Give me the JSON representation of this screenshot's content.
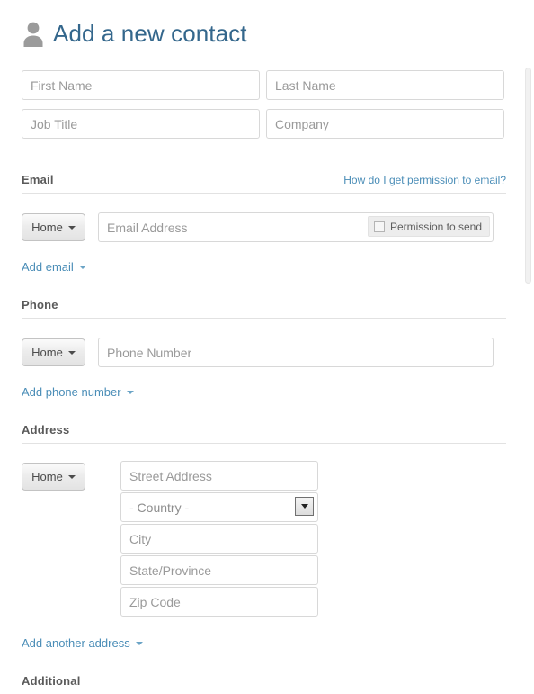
{
  "header": {
    "icon": "person-icon",
    "title": "Add a new contact"
  },
  "name_fields": {
    "first_name_placeholder": "First Name",
    "last_name_placeholder": "Last Name",
    "job_title_placeholder": "Job Title",
    "company_placeholder": "Company"
  },
  "email_section": {
    "title": "Email",
    "help_link": "How do I get permission to email?",
    "type_button": "Home",
    "address_placeholder": "Email Address",
    "permission_label": "Permission to send",
    "permission_checked": false,
    "add_link": "Add email"
  },
  "phone_section": {
    "title": "Phone",
    "type_button": "Home",
    "number_placeholder": "Phone Number",
    "add_link": "Add phone number"
  },
  "address_section": {
    "title": "Address",
    "type_button": "Home",
    "street_placeholder": "Street Address",
    "country_value": "- Country -",
    "city_placeholder": "City",
    "state_placeholder": "State/Province",
    "zip_placeholder": "Zip Code",
    "add_link": "Add another address"
  },
  "additional_section": {
    "title": "Additional"
  },
  "colors": {
    "title_blue": "#34678c",
    "link_blue": "#4a8db7",
    "section_gray": "#5a5a5a",
    "placeholder_gray": "#9a9a9a",
    "border_gray": "#d8d8d8"
  }
}
